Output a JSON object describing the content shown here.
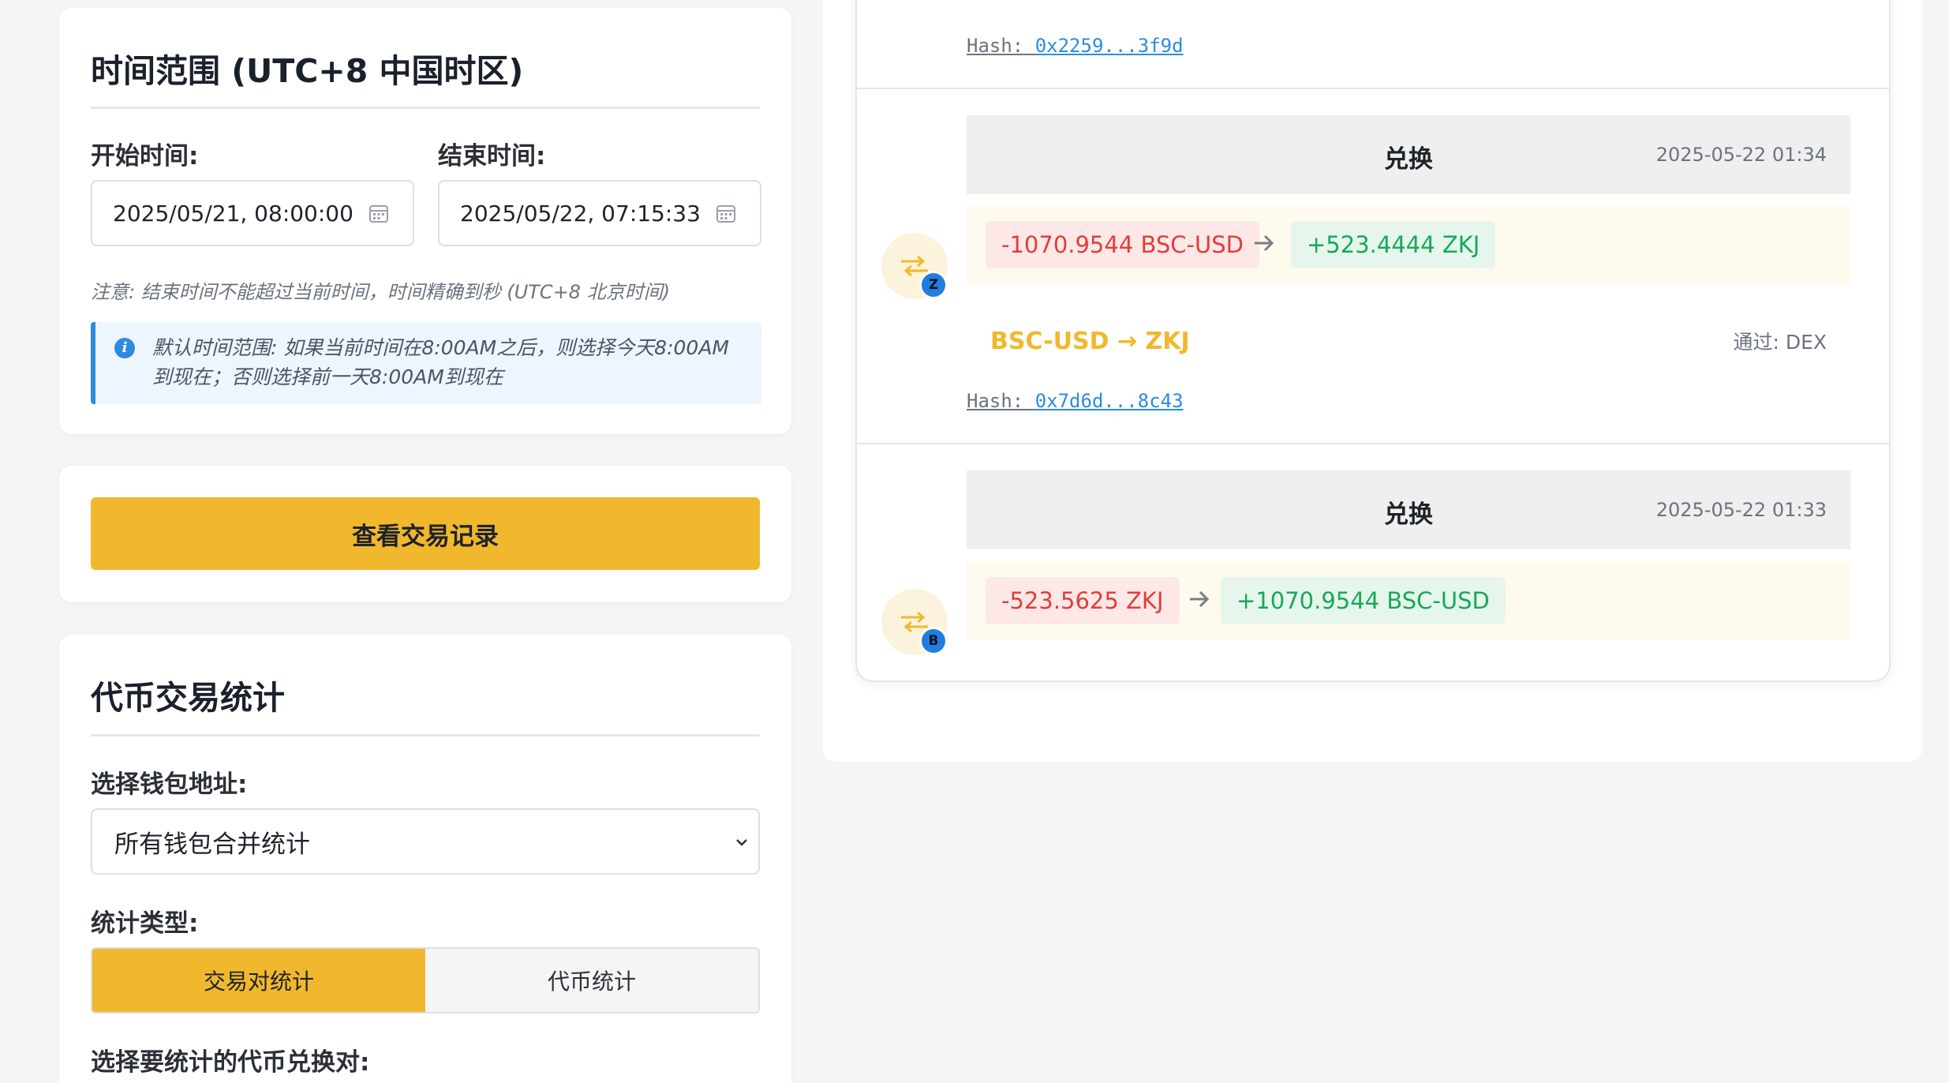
{
  "time_card": {
    "title": "时间范围 (UTC+8 中国时区)",
    "start_label": "开始时间:",
    "end_label": "结束时间:",
    "start_value": "2025/05/21, 08:00:00",
    "end_value": "2025/05/22, 07:15:33",
    "note": "注意: 结束时间不能超过当前时间，时间精确到秒 (UTC+8 北京时间)",
    "info_line1": "默认时间范围: 如果当前时间在8:00AM之后，则选择今天8:00AM",
    "info_line2": "到现在；否则选择前一天8:00AM到现在",
    "info_icon_glyph": "i"
  },
  "query": {
    "button_label": "查看交易记录"
  },
  "stats_card": {
    "title": "代币交易统计",
    "wallet_label": "选择钱包地址:",
    "wallet_value": "所有钱包合并统计",
    "type_label": "统计类型:",
    "tab_pair": "交易对统计",
    "tab_token": "代币统计",
    "pair_select_label": "选择要统计的代币兑换对:"
  },
  "transactions": {
    "top_hash_prefix": "Hash:",
    "top_hash": "0x2259...3f9d",
    "items": [
      {
        "type": "兑换",
        "time": "2025-05-22 01:34",
        "out": "-1070.9544 BSC-USD",
        "in": "+523.4444 ZKJ",
        "avatar_letter": "Z",
        "pair": "BSC-USD → ZKJ",
        "via": "通过: DEX",
        "hash_prefix": "Hash:",
        "hash": "0x7d6d...8c43"
      },
      {
        "type": "兑换",
        "time": "2025-05-22 01:33",
        "out": "-523.5625 ZKJ",
        "in": "+1070.9544 BSC-USD",
        "avatar_letter": "B"
      }
    ]
  },
  "colors": {
    "accent": "#f1b82d",
    "negative": "#e23d3a",
    "positive": "#17a85a",
    "link": "#2b8cdf"
  }
}
